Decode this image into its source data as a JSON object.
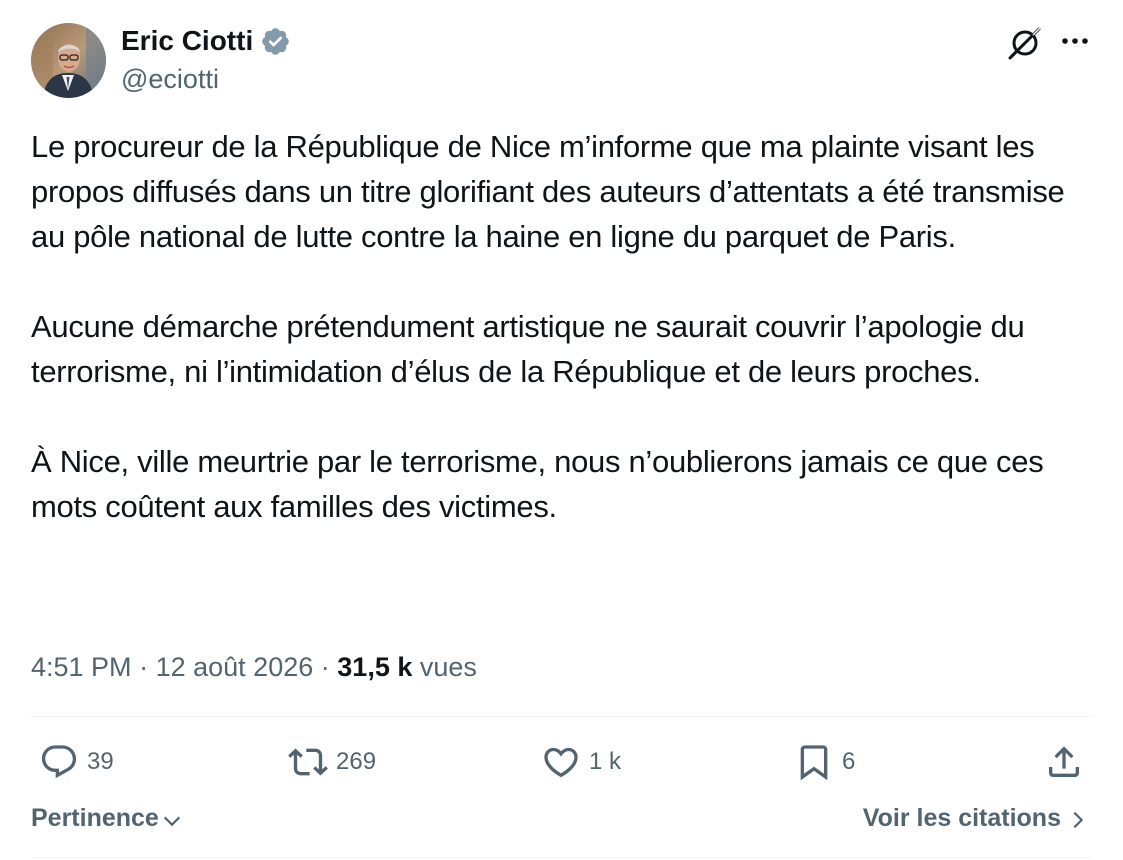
{
  "author": {
    "name": "Eric Ciotti",
    "handle": "@eciotti",
    "verified_badge_color": "#829aab"
  },
  "tweet": {
    "paragraphs": [
      "Le procureur de la République de Nice m’informe que ma plainte visant les propos diffusés dans un titre glorifiant des auteurs d’attentats a été transmise au pôle national de lutte contre la haine en ligne du parquet de Paris.",
      "Aucune démarche prétendument artistique ne saurait couvrir l’apologie du terrorisme, ni l’intimidation d’élus de la République et de leurs proches.",
      "À Nice, ville meurtrie par le terrorisme, nous n’oublierons jamais ce que ces mots coûtent aux familles des victimes."
    ],
    "time": "4:51 PM",
    "separator": "·",
    "date": "12 août 2026",
    "views_count": "31,5 k",
    "views_label": "vues"
  },
  "actions": {
    "replies": "39",
    "reposts": "269",
    "likes": "1 k",
    "bookmarks": "6"
  },
  "footer": {
    "sort_label": "Pertinence",
    "quotes_label": "Voir les citations"
  },
  "icons": {
    "header_right": [
      "grok-icon",
      "more-options-icon"
    ],
    "actions": [
      "reply-icon",
      "repost-icon",
      "like-icon",
      "bookmark-icon",
      "share-icon"
    ]
  },
  "colors": {
    "text_primary": "#0f1419",
    "text_secondary": "#536471",
    "divider": "#eff3f4"
  }
}
